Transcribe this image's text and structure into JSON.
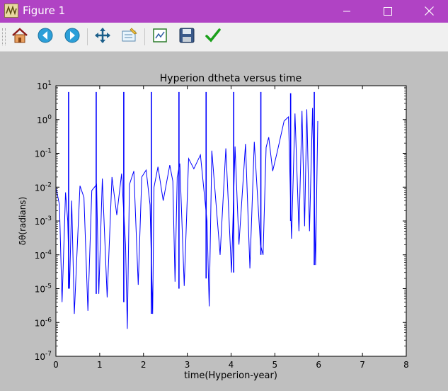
{
  "window": {
    "title": "Figure 1",
    "controls": [
      "minimize",
      "maximize",
      "close"
    ]
  },
  "toolbar": {
    "buttons": [
      {
        "icon": "home-icon"
      },
      {
        "icon": "back-arrow-icon"
      },
      {
        "icon": "forward-arrow-icon"
      },
      {
        "icon": "pan-icon"
      },
      {
        "icon": "configure-subplots-icon"
      },
      {
        "icon": "zoom-rectangle-icon"
      },
      {
        "icon": "save-icon"
      },
      {
        "icon": "checkmark-icon"
      }
    ]
  },
  "colors": {
    "titlebar": "#b043c4",
    "figure_background": "#bfbfbf",
    "line": "#0000ff"
  },
  "chart_data": {
    "type": "line",
    "title": "Hyperion dtheta versus time",
    "xlabel": "time(Hyperion-year)",
    "ylabel": "δθ(radians)",
    "xlim": [
      0,
      8
    ],
    "ylim": [
      1e-07,
      10
    ],
    "yscale": "log",
    "xticks": [
      "0",
      "1",
      "2",
      "3",
      "4",
      "5",
      "6",
      "7",
      "8"
    ],
    "yticks": [
      {
        "base": "10",
        "exp": "1"
      },
      {
        "base": "10",
        "exp": "0"
      },
      {
        "base": "10",
        "exp": "-1"
      },
      {
        "base": "10",
        "exp": "-2"
      },
      {
        "base": "10",
        "exp": "-3"
      },
      {
        "base": "10",
        "exp": "-4"
      },
      {
        "base": "10",
        "exp": "-5"
      },
      {
        "base": "10",
        "exp": "-6"
      },
      {
        "base": "10",
        "exp": "-7"
      }
    ],
    "grid": false,
    "series": [
      {
        "color": "#0000ff",
        "x": [
          0.0,
          0.08,
          0.14,
          0.22,
          0.27,
          0.31,
          0.36,
          0.42,
          0.55,
          0.64,
          0.73,
          0.82,
          0.93,
          0.98,
          1.06,
          1.17,
          1.28,
          1.39,
          1.5,
          1.59,
          1.63,
          1.68,
          1.78,
          1.88,
          1.96,
          2.06,
          2.15,
          2.21,
          2.24,
          2.33,
          2.45,
          2.6,
          2.67,
          2.72,
          2.77,
          2.83,
          2.93,
          3.03,
          3.15,
          3.3,
          3.45,
          3.5,
          3.56,
          3.75,
          3.88,
          4.01,
          4.09,
          4.18,
          4.33,
          4.43,
          4.53,
          4.67,
          4.73,
          4.8,
          4.86,
          4.95,
          5.06,
          5.21,
          5.31,
          5.38,
          5.46,
          5.55,
          5.62,
          5.68,
          5.73,
          5.79,
          5.86,
          5.93,
          5.98
        ],
        "y": [
          0.01,
          0.003,
          4e-06,
          0.007,
          0.001,
          1e-05,
          0.004,
          1.8e-06,
          0.011,
          0.005,
          2.2e-06,
          0.008,
          0.012,
          7e-06,
          0.018,
          5.5e-06,
          0.02,
          0.0015,
          0.025,
          0.0002,
          6.5e-07,
          0.012,
          0.03,
          1.3e-05,
          0.02,
          0.032,
          0.003,
          1.8e-06,
          0.01,
          0.04,
          0.004,
          0.045,
          0.015,
          1.6e-05,
          0.02,
          0.05,
          1.2e-05,
          0.07,
          0.035,
          0.09,
          0.001,
          3e-06,
          0.12,
          0.0001,
          0.14,
          3e-05,
          0.16,
          0.0002,
          0.19,
          4e-05,
          0.22,
          0.0002,
          0.0001,
          0.15,
          0.3,
          0.03,
          0.12,
          0.9,
          1.2,
          0.0003,
          1.5,
          0.0005,
          1.8,
          0.0007,
          2.0,
          0.0005,
          2.2,
          5e-05,
          0.9
        ]
      }
    ],
    "spikes": [
      {
        "x": 0.29,
        "low": 1e-05,
        "high": 6.5
      },
      {
        "x": 0.92,
        "low": 7e-06,
        "high": 6.5
      },
      {
        "x": 1.55,
        "low": 4e-06,
        "high": 6.5
      },
      {
        "x": 2.18,
        "low": 1.8e-06,
        "high": 6.5
      },
      {
        "x": 2.81,
        "low": 1e-05,
        "high": 6.5
      },
      {
        "x": 3.43,
        "low": 2e-05,
        "high": 6.5
      },
      {
        "x": 4.06,
        "low": 3e-05,
        "high": 6.5
      },
      {
        "x": 4.68,
        "low": 0.0001,
        "high": 6.5
      },
      {
        "x": 5.36,
        "low": 0.001,
        "high": 6.0
      },
      {
        "x": 5.9,
        "low": 5e-05,
        "high": 6.5
      }
    ]
  }
}
